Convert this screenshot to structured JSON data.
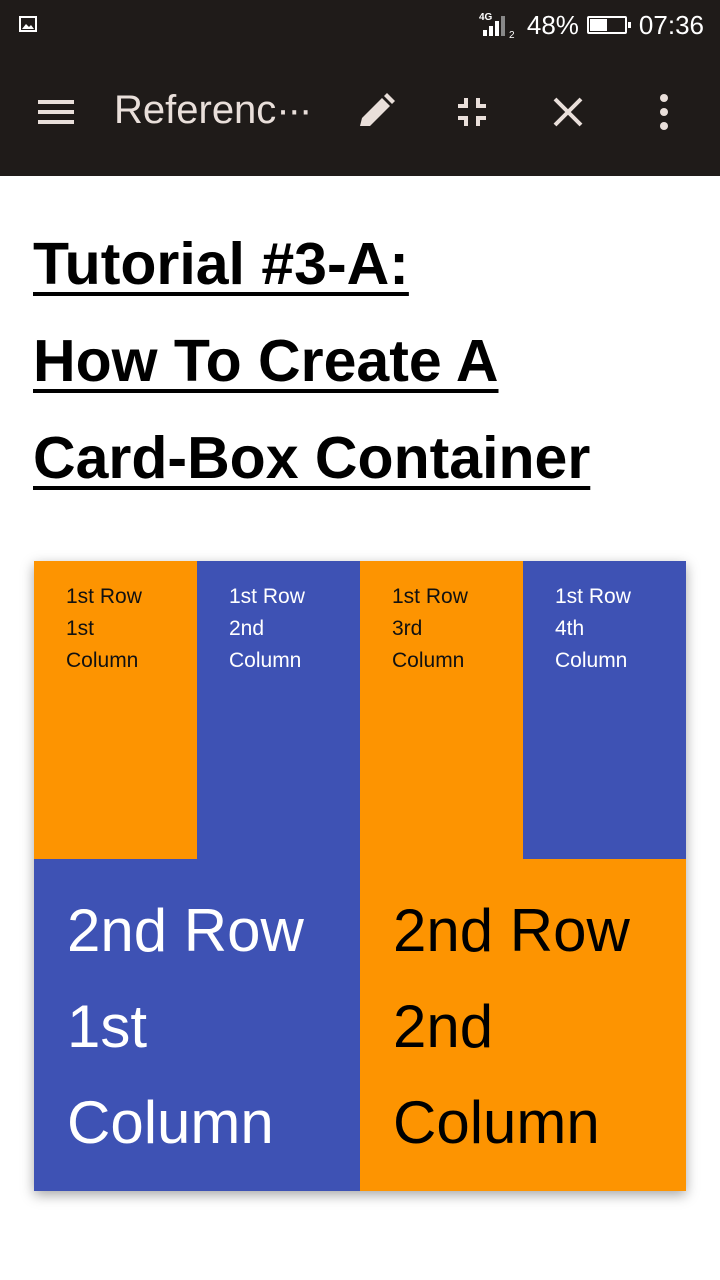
{
  "status_bar": {
    "network_label": "4G",
    "sim_label": "2",
    "battery_percent": "48%",
    "battery_level": 0.48,
    "time": "07:36"
  },
  "app_bar": {
    "title": "Referenc",
    "title_ellipsis": "···",
    "icons": [
      "menu-icon",
      "edit-pencil-icon",
      "exit-fullscreen-icon",
      "close-icon",
      "more-vert-icon"
    ],
    "text_color": "#e9dfda",
    "background": "#1f1b19"
  },
  "page": {
    "heading_lines": [
      "Tutorial #3-A:",
      "How To Create A",
      "Card-Box Container"
    ]
  },
  "card_box": {
    "colors": {
      "orange": "#fd9401",
      "blue": "#3e52b4"
    },
    "row1": [
      {
        "lines": [
          "1st Row",
          "1st",
          "Column"
        ]
      },
      {
        "lines": [
          "1st Row",
          "2nd",
          "Column"
        ]
      },
      {
        "lines": [
          "1st Row",
          "3rd",
          "Column"
        ]
      },
      {
        "lines": [
          "1st Row",
          "4th",
          "Column"
        ]
      }
    ],
    "row2": [
      {
        "lines": [
          "2nd Row",
          "1st",
          "Column"
        ]
      },
      {
        "lines": [
          "2nd Row",
          "2nd",
          "Column"
        ]
      }
    ]
  }
}
